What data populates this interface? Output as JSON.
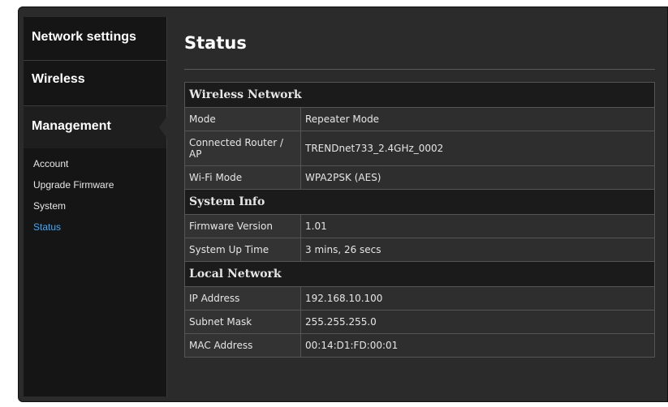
{
  "sidebar": {
    "top_items": [
      {
        "label": "Network settings"
      },
      {
        "label": "Wireless"
      }
    ],
    "management": {
      "label": "Management",
      "sub_items": [
        {
          "label": "Account",
          "active": false
        },
        {
          "label": "Upgrade Firmware",
          "active": false
        },
        {
          "label": "System",
          "active": false
        },
        {
          "label": "Status",
          "active": true
        }
      ]
    }
  },
  "main": {
    "title": "Status",
    "sections": [
      {
        "title": "Wireless Network",
        "rows": [
          {
            "label": "Mode",
            "value": "Repeater Mode"
          },
          {
            "label": "Connected Router / AP",
            "value": "TRENDnet733_2.4GHz_0002"
          },
          {
            "label": "Wi-Fi Mode",
            "value": "WPA2PSK (AES)"
          }
        ]
      },
      {
        "title": "System Info",
        "rows": [
          {
            "label": "Firmware Version",
            "value": "1.01"
          },
          {
            "label": "System Up Time",
            "value": "3 mins, 26 secs"
          }
        ]
      },
      {
        "title": "Local Network",
        "rows": [
          {
            "label": "IP Address",
            "value": "192.168.10.100"
          },
          {
            "label": "Subnet Mask",
            "value": "255.255.255.0"
          },
          {
            "label": "MAC Address",
            "value": "00:14:D1:FD:00:01"
          }
        ]
      }
    ]
  },
  "colors": {
    "active_link": "#3fa9ff",
    "panel_bg": "#2b2b2b",
    "sidebar_bg": "#151515"
  }
}
